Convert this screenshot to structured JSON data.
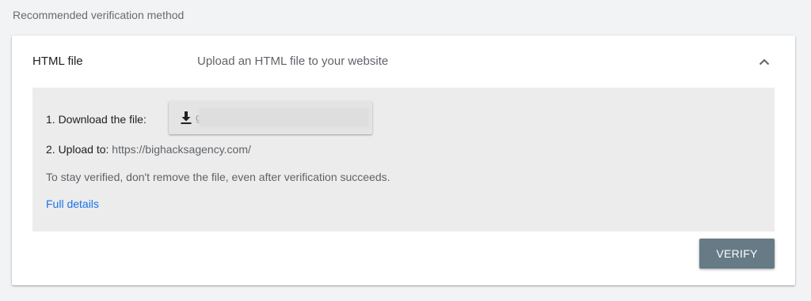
{
  "section": {
    "heading": "Recommended verification method"
  },
  "method": {
    "title": "HTML file",
    "description": "Upload an HTML file to your website",
    "expanded_icon": "chevron-up-icon"
  },
  "steps": {
    "download_label": "1. Download the file:",
    "download_filename": "g",
    "download_icon": "download-icon",
    "upload_label": "2. Upload to:",
    "upload_url": "https://bighacksagency.com/"
  },
  "note": "To stay verified, don't remove the file, even after verification succeeds.",
  "full_details_link": "Full details",
  "verify_button": "VERIFY",
  "colors": {
    "page_background": "#f1f3f4",
    "panel_background": "#ececec",
    "link": "#1a73e8",
    "verify_button": "#667b86"
  }
}
